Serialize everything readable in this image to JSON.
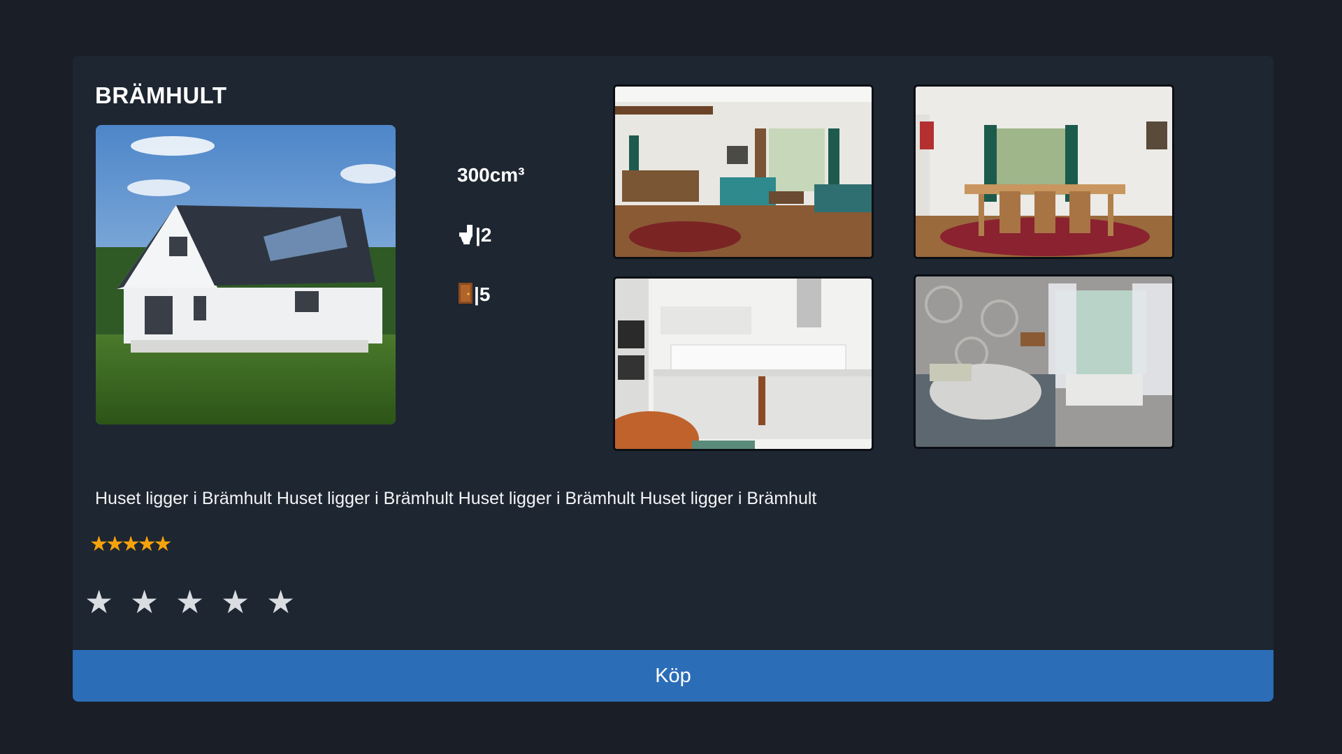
{
  "house": {
    "title": "BRÄMHULT",
    "area": "300cm³",
    "toilet_icon": "toilet-icon",
    "toilets": "|2",
    "door_icon": "door-icon",
    "rooms": "|5",
    "description": "Huset ligger i Brämhult Huset ligger i Brämhult Huset ligger i Brämhult Huset ligger i Brämhult"
  },
  "rating": {
    "average": 5,
    "average_stars": "★★★★★",
    "average_color": "#f5a20c",
    "input_star": "★",
    "max": 5
  },
  "buy_label": "Köp",
  "colors": {
    "background": "#1a1e27",
    "card": "#1e2631",
    "button": "#2b6db7"
  }
}
